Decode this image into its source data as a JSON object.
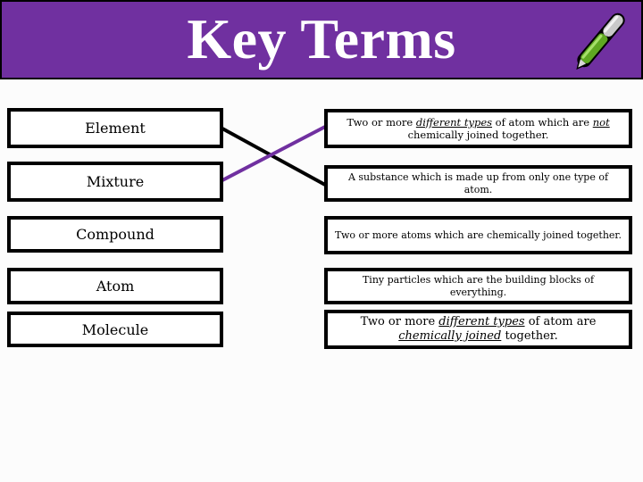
{
  "header": {
    "title": "Key Terms",
    "icon": "pen-icon",
    "background_color": "#7030a0"
  },
  "terms": [
    {
      "label": "Element"
    },
    {
      "label": "Mixture"
    },
    {
      "label": "Compound"
    },
    {
      "label": "Atom"
    },
    {
      "label": "Molecule"
    }
  ],
  "definitions": [
    {
      "parts": [
        "Two or more ",
        "different types",
        " of atom which are ",
        "not",
        " chemically joined together."
      ]
    },
    {
      "text": "A substance which is made up from only one type of atom."
    },
    {
      "text": "Two or more atoms which are chemically joined together."
    },
    {
      "text": "Tiny particles which are the building blocks of everything."
    },
    {
      "parts": [
        "Two or more ",
        "different types",
        " of atom are ",
        "chemically joined",
        " together."
      ]
    }
  ],
  "connections": [
    {
      "from_term": "Element",
      "to_definition_index": 1,
      "color": "#000000"
    },
    {
      "from_term": "Mixture",
      "to_definition_index": 0,
      "color": "#7030a0"
    }
  ]
}
